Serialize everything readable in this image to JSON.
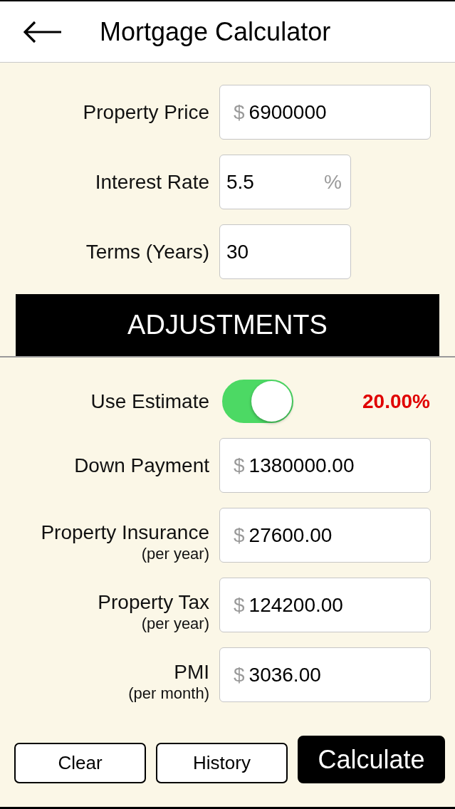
{
  "header": {
    "title": "Mortgage Calculator"
  },
  "loan_fields": [
    {
      "label": "Property Price",
      "prefix": "$",
      "value": "6900000"
    },
    {
      "label": "Interest Rate",
      "value": "5.5",
      "suffix": "%"
    },
    {
      "label": "Terms (Years)",
      "value": "30"
    }
  ],
  "adjustments": {
    "title": "ADJUSTMENTS",
    "use_estimate": {
      "label": "Use Estimate",
      "on": true,
      "percent": "20.00%"
    },
    "fields": [
      {
        "label": "Down Payment",
        "prefix": "$",
        "value": "1380000.00"
      },
      {
        "label": "Property Insurance",
        "sublabel": "(per year)",
        "prefix": "$",
        "value": "27600.00"
      },
      {
        "label": "Property Tax",
        "sublabel": "(per year)",
        "prefix": "$",
        "value": "124200.00"
      },
      {
        "label": "PMI",
        "sublabel": "(per month)",
        "prefix": "$",
        "value": "3036.00"
      }
    ]
  },
  "buttons": [
    {
      "label": "Clear",
      "kind": "outline"
    },
    {
      "label": "History",
      "kind": "outline"
    },
    {
      "label": "Calculate",
      "kind": "filled"
    }
  ]
}
